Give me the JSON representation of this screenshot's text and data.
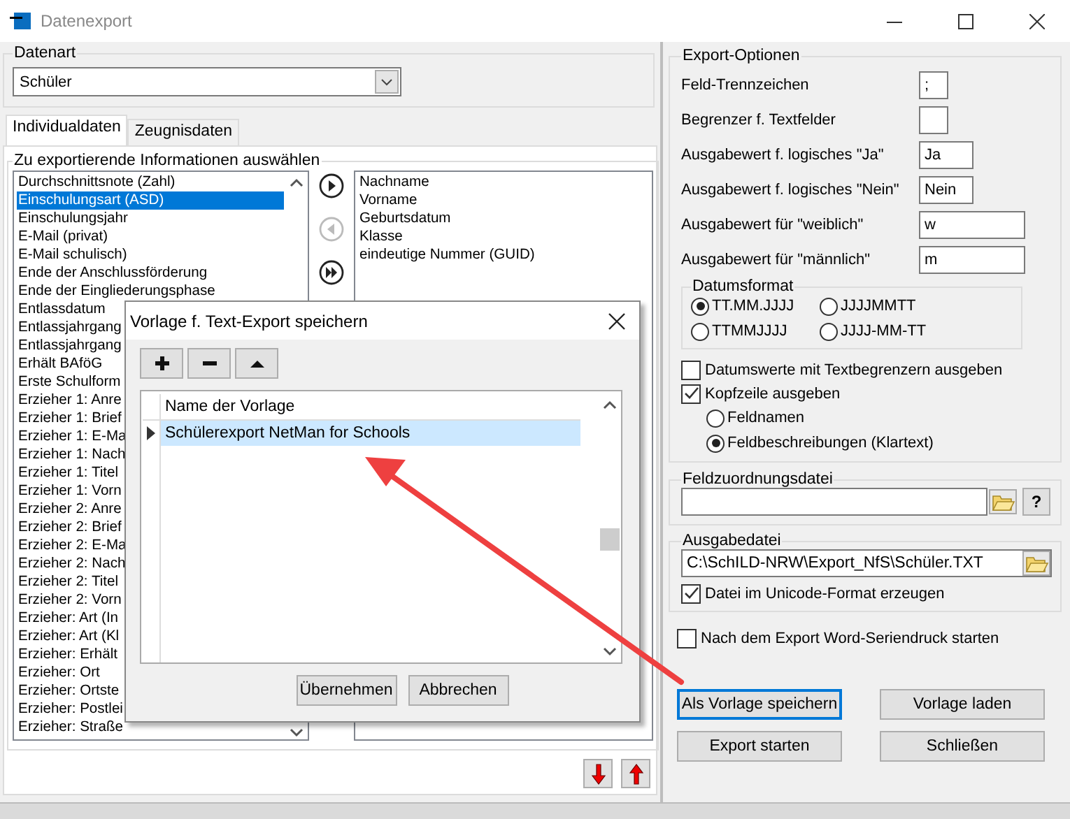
{
  "window": {
    "title": "Datenexport"
  },
  "datenart": {
    "legend": "Datenart",
    "value": "Schüler"
  },
  "tabs": [
    {
      "label": "Individualdaten",
      "selected": true
    },
    {
      "label": "Zeugnisdaten",
      "selected": false
    }
  ],
  "selection": {
    "legend": "Zu exportierende Informationen auswählen",
    "available": [
      {
        "label": "Durchschnittsnote (Zahl)",
        "selected": false
      },
      {
        "label": "Einschulungsart (ASD)",
        "selected": true
      },
      {
        "label": "Einschulungsjahr",
        "selected": false
      },
      {
        "label": "E-Mail (privat)",
        "selected": false
      },
      {
        "label": "E-Mail schulisch)",
        "selected": false
      },
      {
        "label": "Ende der Anschlussförderung",
        "selected": false
      },
      {
        "label": "Ende der Eingliederungsphase",
        "selected": false
      },
      {
        "label": "Entlassdatum",
        "selected": false
      },
      {
        "label": "Entlassjahrgang",
        "selected": false
      },
      {
        "label": "Entlassjahrgang",
        "selected": false
      },
      {
        "label": "Erhält BAföG",
        "selected": false
      },
      {
        "label": "Erste Schulform",
        "selected": false
      },
      {
        "label": "Erzieher 1: Anre",
        "selected": false
      },
      {
        "label": "Erzieher 1: Brief",
        "selected": false
      },
      {
        "label": "Erzieher 1: E-Ma",
        "selected": false
      },
      {
        "label": "Erzieher 1: Nach",
        "selected": false
      },
      {
        "label": "Erzieher 1: Titel",
        "selected": false
      },
      {
        "label": "Erzieher 1: Vorn",
        "selected": false
      },
      {
        "label": "Erzieher 2: Anre",
        "selected": false
      },
      {
        "label": "Erzieher 2: Brief",
        "selected": false
      },
      {
        "label": "Erzieher 2: E-Ma",
        "selected": false
      },
      {
        "label": "Erzieher 2: Nach",
        "selected": false
      },
      {
        "label": "Erzieher 2: Titel",
        "selected": false
      },
      {
        "label": "Erzieher 2: Vorn",
        "selected": false
      },
      {
        "label": "Erzieher: Art (In",
        "selected": false
      },
      {
        "label": "Erzieher: Art (Kl",
        "selected": false
      },
      {
        "label": "Erzieher: Erhält",
        "selected": false
      },
      {
        "label": "Erzieher: Ort",
        "selected": false
      },
      {
        "label": "Erzieher: Ortste",
        "selected": false
      },
      {
        "label": "Erzieher: Postlei",
        "selected": false
      },
      {
        "label": "Erzieher: Straße",
        "selected": false
      }
    ],
    "transfer_buttons": [
      {
        "kind": "add",
        "disabled": false
      },
      {
        "kind": "remove",
        "disabled": true
      },
      {
        "kind": "add_all",
        "disabled": false
      }
    ],
    "chosen": [
      "Nachname",
      "Vorname",
      "Geburtsdatum",
      "Klasse",
      "eindeutige Nummer (GUID)"
    ],
    "order_buttons": [
      {
        "kind": "down"
      },
      {
        "kind": "up"
      }
    ]
  },
  "export_options": {
    "legend": "Export-Optionen",
    "fields": [
      {
        "label": "Feld-Trennzeichen",
        "value": ";",
        "kind": "tiny"
      },
      {
        "label": "Begrenzer f. Textfelder",
        "kind": "tiny"
      },
      {
        "label": "Ausgabewert f. logisches \"Ja\"",
        "value": "Ja",
        "kind": "short"
      },
      {
        "label": "Ausgabewert f. logisches \"Nein\"",
        "value": "Nein",
        "kind": "short"
      },
      {
        "label": "Ausgabewert für \"weiblich\"",
        "value": "w",
        "kind": "wide"
      },
      {
        "label": "Ausgabewert für \"männlich\"",
        "value": "m",
        "kind": "wide"
      }
    ],
    "date_format": {
      "legend": "Datumsformat",
      "options": [
        {
          "label": "TT.MM.JJJJ",
          "selected": true
        },
        {
          "label": "JJJJMMTT",
          "selected": false
        },
        {
          "label": "TTMMJJJJ",
          "selected": false
        },
        {
          "label": "JJJJ-MM-TT",
          "selected": false
        }
      ]
    },
    "date_delimiters": {
      "label": "Datumswerte mit Textbegrenzern ausgeben",
      "checked": false
    },
    "header_line": {
      "label": "Kopfzeile ausgeben",
      "checked": true
    },
    "header_options": [
      {
        "label": "Feldnamen",
        "selected": false
      },
      {
        "label": "Feldbeschreibungen (Klartext)",
        "selected": true
      }
    ]
  },
  "mapping_file": {
    "legend": "Feldzuordnungsdatei",
    "help": "?"
  },
  "output_file": {
    "legend": "Ausgabedatei",
    "value": "C:\\SchILD-NRW\\Export_NfS\\Schüler.TXT",
    "unicode": {
      "label": "Datei im Unicode-Format erzeugen",
      "checked": true
    }
  },
  "mail_merge": {
    "label": "Nach dem Export Word-Seriendruck starten",
    "checked": false
  },
  "buttons": [
    {
      "label": "Als Vorlage speichern",
      "focused": true
    },
    {
      "label": "Vorlage laden",
      "focused": false
    },
    {
      "label": "Export starten",
      "focused": false
    },
    {
      "label": "Schließen",
      "focused": false
    }
  ],
  "dialog": {
    "title": "Vorlage f. Text-Export speichern",
    "toolbar": [
      {
        "kind": "add"
      },
      {
        "kind": "remove"
      },
      {
        "kind": "up"
      }
    ],
    "column": "Name der Vorlage",
    "templates": [
      {
        "name": "Schülerexport NetMan for Schools",
        "selected": true
      }
    ],
    "buttons": [
      "Übernehmen",
      "Abbrechen"
    ]
  }
}
